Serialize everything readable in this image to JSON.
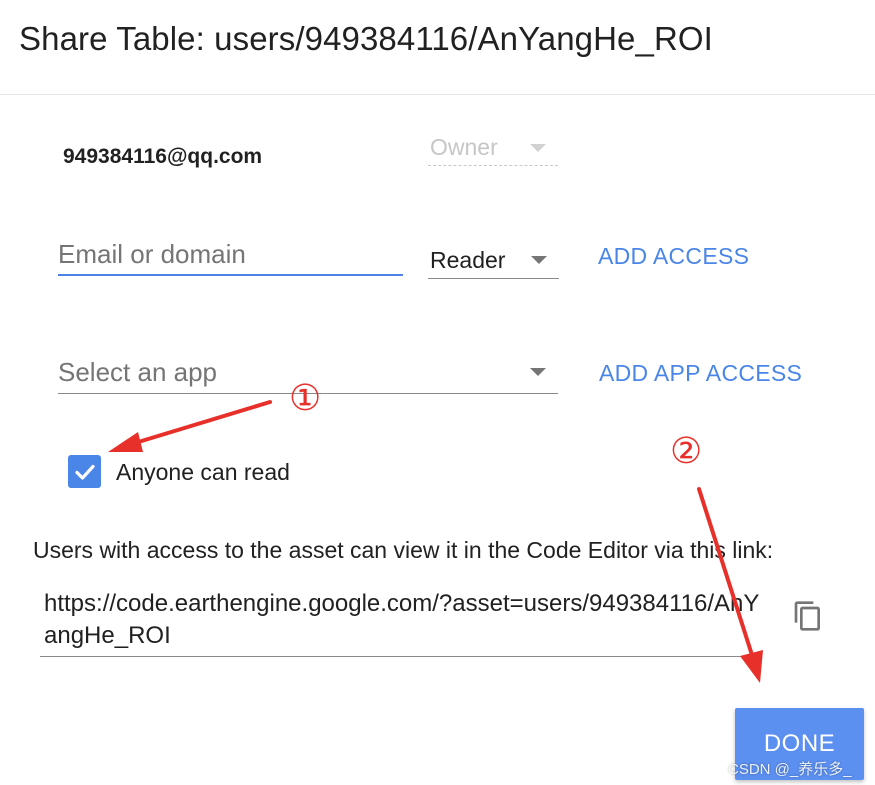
{
  "dialog": {
    "title": "Share Table: users/949384116/AnYangHe_ROI"
  },
  "owner": {
    "email": "949384116@qq.com",
    "role": "Owner"
  },
  "add_access": {
    "email_placeholder": "Email or domain",
    "role": "Reader",
    "button_label": "ADD ACCESS"
  },
  "app_access": {
    "select_placeholder": "Select an app",
    "button_label": "ADD APP ACCESS"
  },
  "anyone_can_read": {
    "label": "Anyone can read",
    "checked": true
  },
  "link": {
    "description": "Users with access to the asset can view it in the Code Editor via this link:",
    "url": "https://code.earthengine.google.com/?asset=users/949384116/AnYangHe_ROI"
  },
  "done_label": "DONE",
  "annotations": {
    "marker_1": "①",
    "marker_2": "②",
    "color": "#e8302a"
  },
  "watermark": "CSDN @_养乐多_",
  "colors": {
    "accent": "#4a86e8",
    "done_button": "#5b8ff0",
    "text": "#212121",
    "placeholder": "#757575"
  },
  "icons": {
    "role_dropdown": "chevron-down-icon",
    "checkbox": "check-icon",
    "copy": "copy-icon"
  }
}
